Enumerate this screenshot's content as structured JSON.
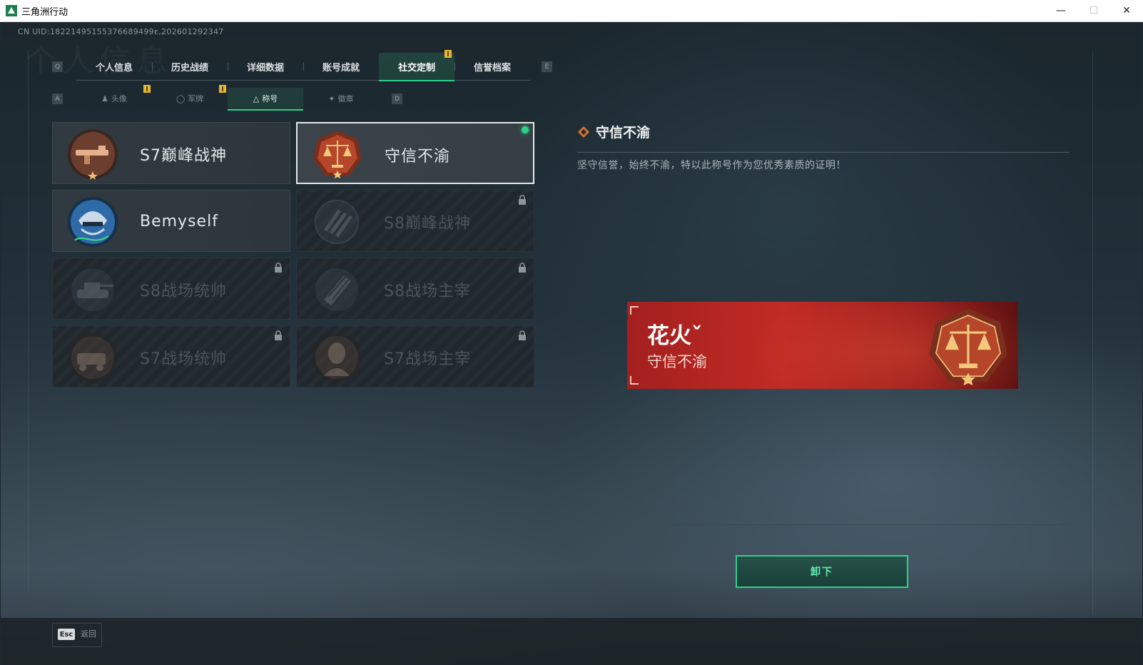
{
  "window": {
    "title": "三角洲行动",
    "controls": [
      "—",
      "☐",
      "✕"
    ]
  },
  "header": {
    "uid": "CN UID:18221495155376689499ε,202601292347"
  },
  "main_tabs": {
    "left_key": "Q",
    "right_key": "E",
    "items": [
      {
        "label": "个人信息"
      },
      {
        "label": "历史战绩"
      },
      {
        "label": "详细数据"
      },
      {
        "label": "账号成就"
      },
      {
        "label": "社交定制"
      },
      {
        "label": "信誉档案"
      }
    ]
  },
  "sub_tabs": {
    "left_key": "A",
    "right_key": "D",
    "items": [
      {
        "label": "头像",
        "icon": "person-icon"
      },
      {
        "label": "军牌",
        "icon": "dogtag-icon"
      },
      {
        "label": "称号",
        "icon": "title-icon"
      },
      {
        "label": "徽章",
        "icon": "badge-icon"
      }
    ]
  },
  "titles": [
    {
      "label": "S7巅峰战神",
      "locked": false,
      "selected": false,
      "emblem": "rifle-emblem-icon"
    },
    {
      "label": "守信不渝",
      "locked": false,
      "selected": true,
      "equipped": true,
      "emblem": "scales-emblem-icon"
    },
    {
      "label": "Bemyself",
      "locked": false,
      "selected": false,
      "emblem": "soldier-helmet-emblem-icon"
    },
    {
      "label": "S8巅峰战神",
      "locked": true,
      "selected": false,
      "emblem": "stripes-emblem-icon"
    },
    {
      "label": "S8战场统帅",
      "locked": true,
      "selected": false,
      "emblem": "tank-emblem-icon"
    },
    {
      "label": "S8战场主宰",
      "locked": true,
      "selected": false,
      "emblem": "rocket-launcher-emblem-icon"
    },
    {
      "label": "S7战场统帅",
      "locked": true,
      "selected": false,
      "emblem": "armored-vehicle-emblem-icon"
    },
    {
      "label": "S7战场主宰",
      "locked": true,
      "selected": false,
      "emblem": "operator-portrait-emblem-icon"
    }
  ],
  "detail": {
    "title": "守信不渝",
    "description": "坚守信誉，始终不渝，特以此称号作为您优秀素质的证明！",
    "preview": {
      "player_name": "花火ˇ",
      "title": "守信不渝"
    },
    "action_label": "卸下"
  },
  "footer": {
    "esc_key": "Esc",
    "esc_label": "返回"
  },
  "colors": {
    "accent": "#2fd08b",
    "badge": "#e9b92c",
    "preview_red": "#c12b25"
  }
}
